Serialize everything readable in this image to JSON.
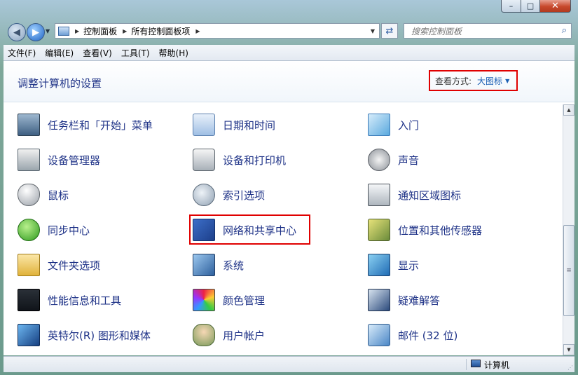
{
  "window": {
    "close_symbol": "✕",
    "max_symbol": "□",
    "min_symbol": "–"
  },
  "address": {
    "crumbs": [
      "控制面板",
      "所有控制面板项"
    ],
    "refresh_icon": "refresh-icon"
  },
  "search": {
    "placeholder": "搜索控制面板"
  },
  "menu": {
    "items": [
      "文件(F)",
      "编辑(E)",
      "查看(V)",
      "工具(T)",
      "帮助(H)"
    ]
  },
  "page": {
    "title": "调整计算机的设置",
    "view_by_label": "查看方式:",
    "view_by_value": "大图标"
  },
  "items": [
    {
      "label": "任务栏和「开始」菜单",
      "icon": "taskbar-icon"
    },
    {
      "label": "日期和时间",
      "icon": "calendar-clock-icon"
    },
    {
      "label": "入门",
      "icon": "getting-started-icon"
    },
    {
      "label": "设备管理器",
      "icon": "device-manager-icon"
    },
    {
      "label": "设备和打印机",
      "icon": "printer-icon"
    },
    {
      "label": "声音",
      "icon": "speaker-icon"
    },
    {
      "label": "鼠标",
      "icon": "mouse-icon"
    },
    {
      "label": "索引选项",
      "icon": "indexing-icon"
    },
    {
      "label": "通知区域图标",
      "icon": "notification-area-icon"
    },
    {
      "label": "同步中心",
      "icon": "sync-icon"
    },
    {
      "label": "网络和共享中心",
      "icon": "network-icon"
    },
    {
      "label": "位置和其他传感器",
      "icon": "location-sensor-icon"
    },
    {
      "label": "文件夹选项",
      "icon": "folder-options-icon"
    },
    {
      "label": "系统",
      "icon": "system-icon"
    },
    {
      "label": "显示",
      "icon": "display-icon"
    },
    {
      "label": "性能信息和工具",
      "icon": "performance-icon"
    },
    {
      "label": "颜色管理",
      "icon": "color-management-icon"
    },
    {
      "label": "疑难解答",
      "icon": "troubleshooting-icon"
    },
    {
      "label": "英特尔(R) 图形和媒体",
      "icon": "intel-graphics-icon"
    },
    {
      "label": "用户帐户",
      "icon": "user-accounts-icon"
    },
    {
      "label": "邮件 (32 位)",
      "icon": "mail-icon"
    }
  ],
  "status": {
    "location": "计算机"
  }
}
